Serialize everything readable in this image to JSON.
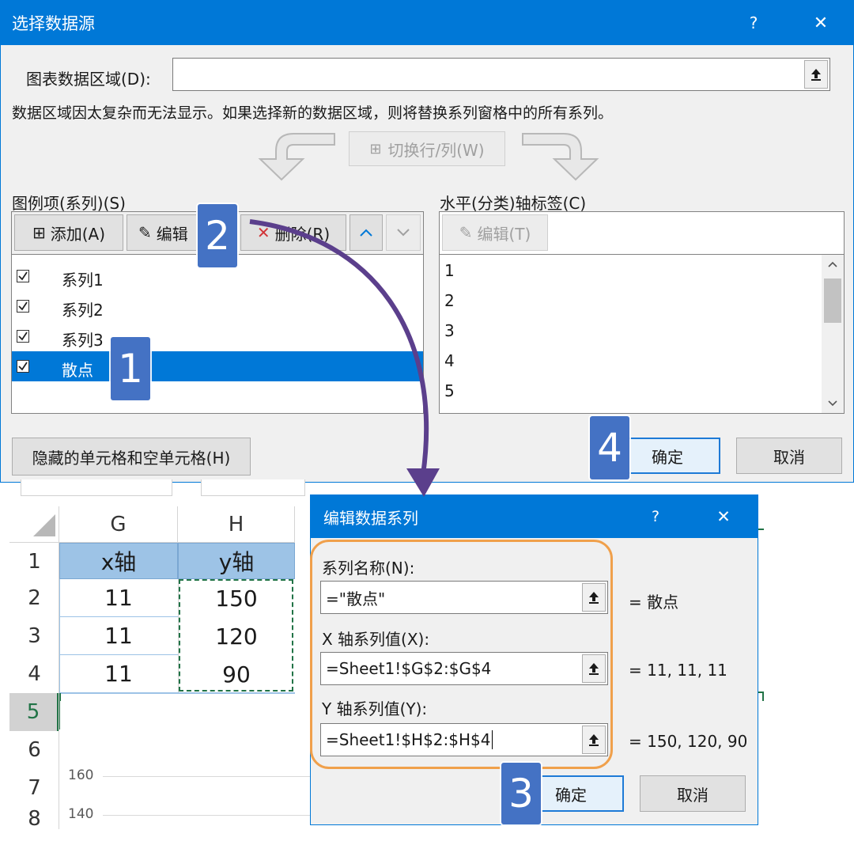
{
  "dialog1": {
    "title": "选择数据源",
    "help": "?",
    "close": "✕",
    "range_label": "图表数据区域(D):",
    "range_value": "",
    "info": "数据区域因太复杂而无法显示。如果选择新的数据区域，则将替换系列窗格中的所有系列。",
    "switch_label": "切换行/列(W)",
    "legend_label": "图例项(系列)(S)",
    "add_label": "添加(A)",
    "edit_label": "编辑",
    "delete_label": "删除(R)",
    "series": [
      {
        "name": "系列1",
        "checked": true
      },
      {
        "name": "系列2",
        "checked": true
      },
      {
        "name": "系列3",
        "checked": true
      },
      {
        "name": "散点",
        "checked": true,
        "selected": true
      }
    ],
    "axis_label": "水平(分类)轴标签(C)",
    "axis_edit_label": "编辑(T)",
    "axis_items": [
      "1",
      "2",
      "3",
      "4",
      "5"
    ],
    "hidden_cells_label": "隐藏的单元格和空单元格(H)",
    "ok_label": "确定",
    "cancel_label": "取消"
  },
  "sheet": {
    "columns": [
      "G",
      "H"
    ],
    "header_row": [
      "x轴",
      "y轴"
    ],
    "rows": [
      {
        "num": "1"
      },
      {
        "num": "2",
        "g": "11",
        "h": "150"
      },
      {
        "num": "3",
        "g": "11",
        "h": "120"
      },
      {
        "num": "4",
        "g": "11",
        "h": "90"
      },
      {
        "num": "5"
      },
      {
        "num": "6"
      },
      {
        "num": "7"
      },
      {
        "num": "8"
      }
    ],
    "axis_ticks": [
      "160",
      "140"
    ]
  },
  "dialog2": {
    "title": "编辑数据系列",
    "help": "?",
    "close": "✕",
    "name_label": "系列名称(N):",
    "name_value": "=\"散点\"",
    "name_preview": "= 散点",
    "x_label": "X 轴系列值(X):",
    "x_value": "=Sheet1!$G$2:$G$4",
    "x_preview": "= 11, 11, 11",
    "y_label": "Y 轴系列值(Y):",
    "y_value": "=Sheet1!$H$2:$H$4",
    "y_preview": "= 150, 120, 90",
    "ok_label": "确定",
    "cancel_label": "取消"
  },
  "badges": [
    "1",
    "2",
    "3",
    "4"
  ],
  "colors": {
    "titlebar": "#0078d7",
    "selection": "#0078d7",
    "badge": "#4472c4",
    "arrow": "#5b3f8c",
    "highlight_ring": "#f0a04b",
    "header_fill": "#9dc3e6",
    "marching_ants": "#217346"
  }
}
